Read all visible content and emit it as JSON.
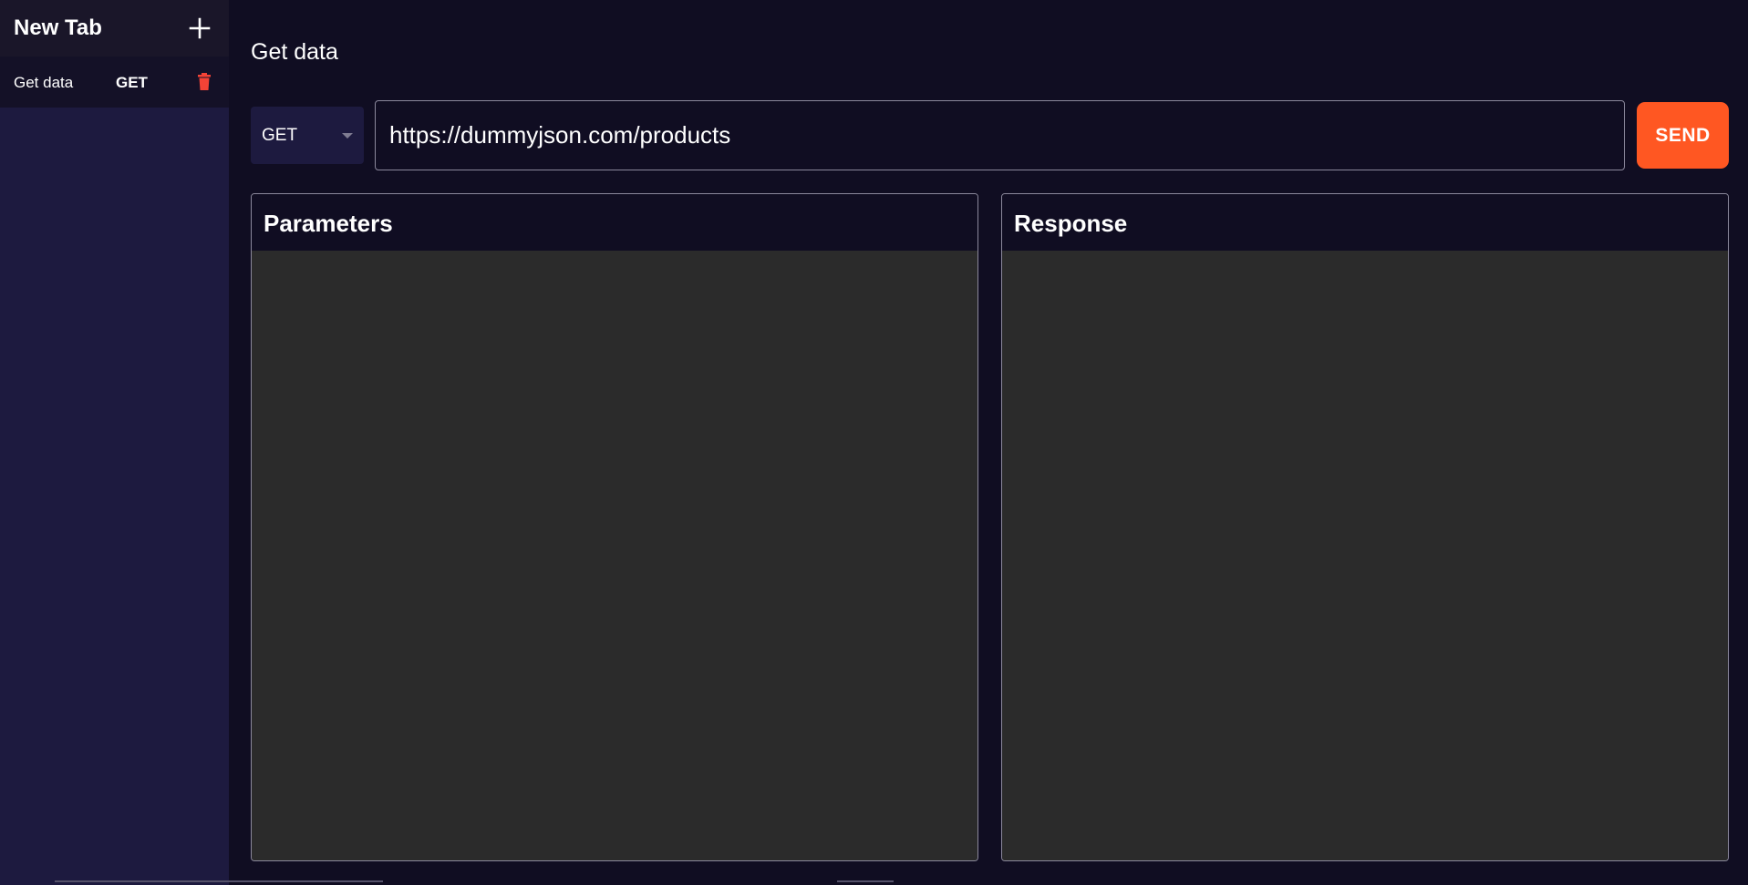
{
  "sidebar": {
    "title": "New Tab",
    "add_icon": "plus-icon",
    "tabs": [
      {
        "name": "Get data",
        "method": "GET",
        "delete_icon": "trash-icon"
      }
    ]
  },
  "main": {
    "title": "Get data",
    "method_select": {
      "value": "GET"
    },
    "url_input": {
      "value": "https://dummyjson.com/products"
    },
    "send_label": "SEND",
    "panels": {
      "parameters_title": "Parameters",
      "response_title": "Response"
    }
  },
  "colors": {
    "background": "#100d22",
    "sidebar": "#1d1a3f",
    "accent": "#ff5722",
    "delete": "#f44336",
    "panel_body": "#2b2b2b"
  }
}
